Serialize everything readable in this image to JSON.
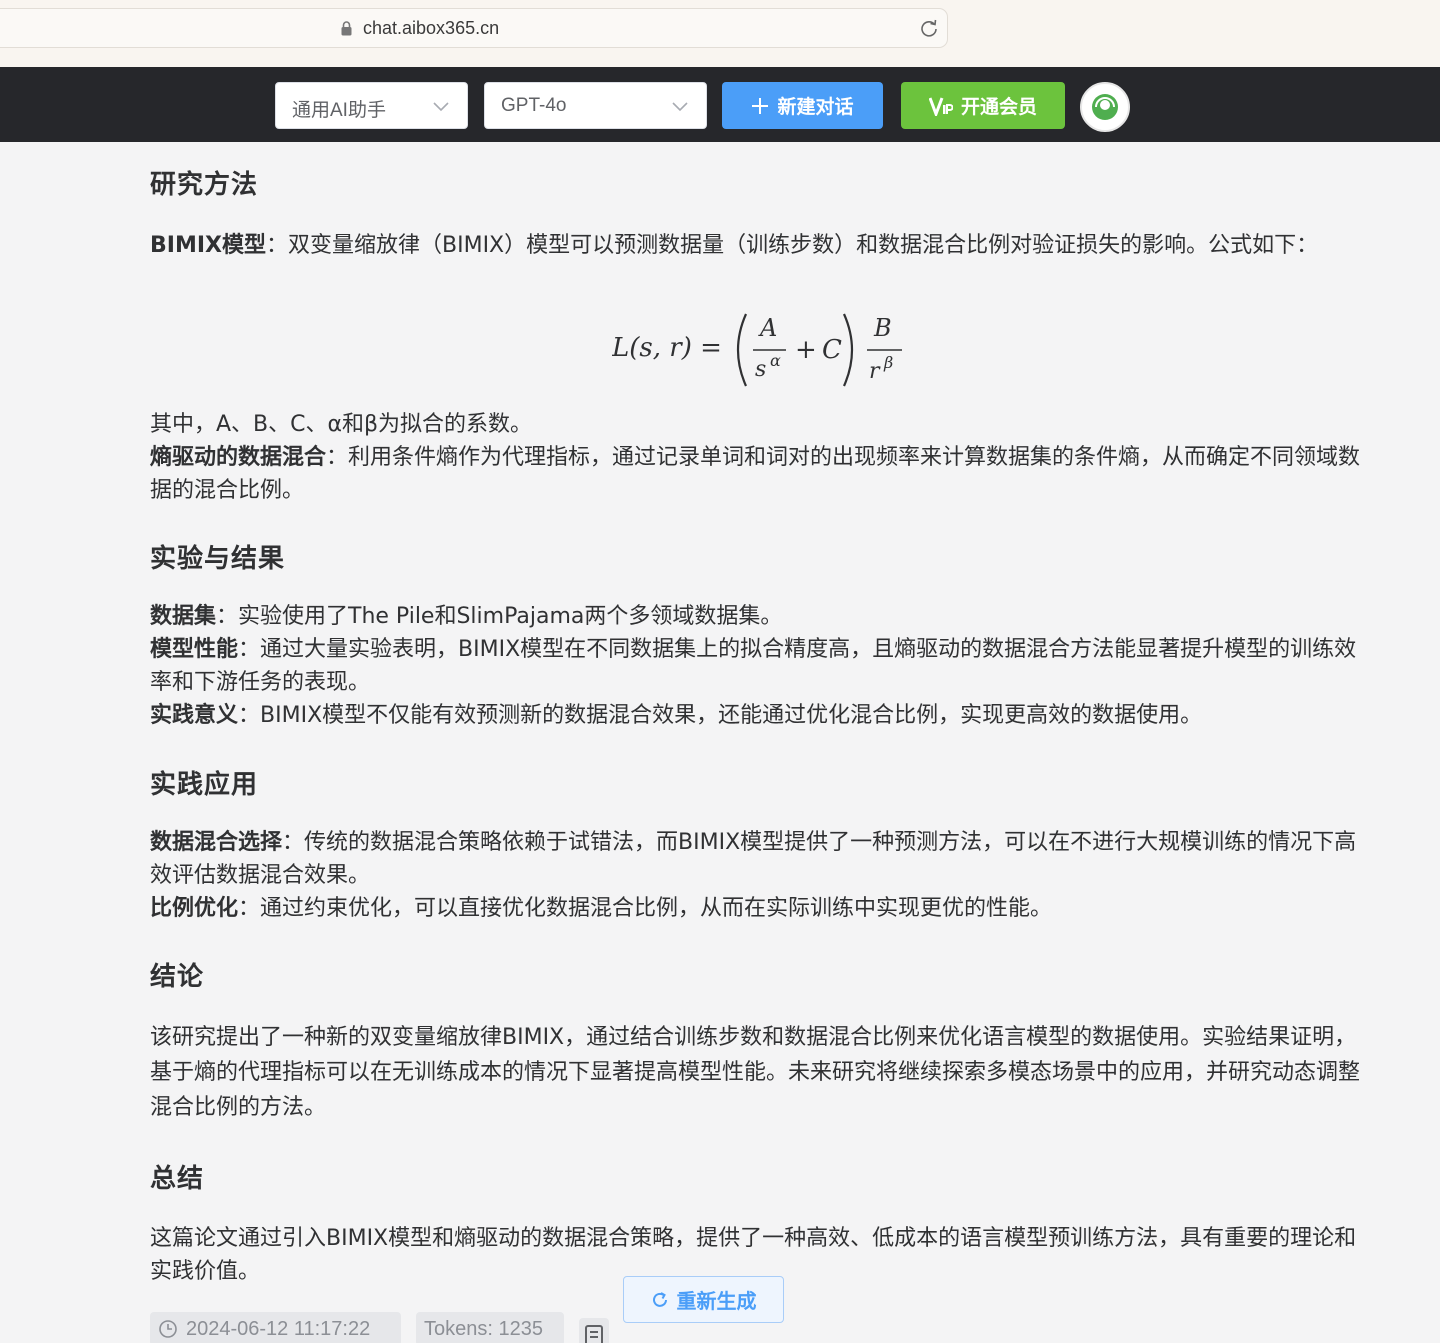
{
  "browser": {
    "url": "chat.aibox365.cn"
  },
  "toolbar": {
    "assistant_select": "通用AI助手",
    "model_select": "GPT-4o",
    "new_chat_label": "新建对话",
    "vip_label": "开通会员"
  },
  "article": {
    "s1": {
      "title": "研究方法",
      "bimix_term": "BIMIX模型",
      "bimix_text": "：双变量缩放律（BIMIX）模型可以预测数据量（训练步数）和数据混合比例对验证损失的影响。公式如下：",
      "formula_note": "其中，A、B、C、α和β为拟合的系数。",
      "entropy_term": "熵驱动的数据混合",
      "entropy_text": "：利用条件熵作为代理指标，通过记录单词和词对的出现频率来计算数据集的条件熵，从而确定不同领域数据的混合比例。"
    },
    "s2": {
      "title": "实验与结果",
      "dataset_term": "数据集",
      "dataset_text": "：实验使用了The Pile和SlimPajama两个多领域数据集。",
      "perf_term": "模型性能",
      "perf_text": "：通过大量实验表明，BIMIX模型在不同数据集上的拟合精度高，且熵驱动的数据混合方法能显著提升模型的训练效率和下游任务的表现。",
      "practice_term": "实践意义",
      "practice_text": "：BIMIX模型不仅能有效预测新的数据混合效果，还能通过优化混合比例，实现更高效的数据使用。"
    },
    "s3": {
      "title": "实践应用",
      "mix_term": "数据混合选择",
      "mix_text": "：传统的数据混合策略依赖于试错法，而BIMIX模型提供了一种预测方法，可以在不进行大规模训练的情况下高效评估数据混合效果。",
      "ratio_term": "比例优化",
      "ratio_text": "：通过约束优化，可以直接优化数据混合比例，从而在实际训练中实现更优的性能。"
    },
    "s4": {
      "title": "结论",
      "text": "该研究提出了一种新的双变量缩放律BIMIX，通过结合训练步数和数据混合比例来优化语言模型的数据使用。实验结果证明，基于熵的代理指标可以在无训练成本的情况下显著提高模型性能。未来研究将继续探索多模态场景中的应用，并研究动态调整混合比例的方法。"
    },
    "s5": {
      "title": "总结",
      "text": "这篇论文通过引入BIMIX模型和熵驱动的数据混合策略，提供了一种高效、低成本的语言模型预训练方法，具有重要的理论和实践价值。"
    }
  },
  "footer": {
    "regenerate_label": "重新生成",
    "timestamp": "2024-06-12 11:17:22",
    "tokens": "Tokens: 1235"
  },
  "colors": {
    "toolbar_bg": "#26272b",
    "primary": "#4b9ef8",
    "vip": "#6cc33d"
  }
}
